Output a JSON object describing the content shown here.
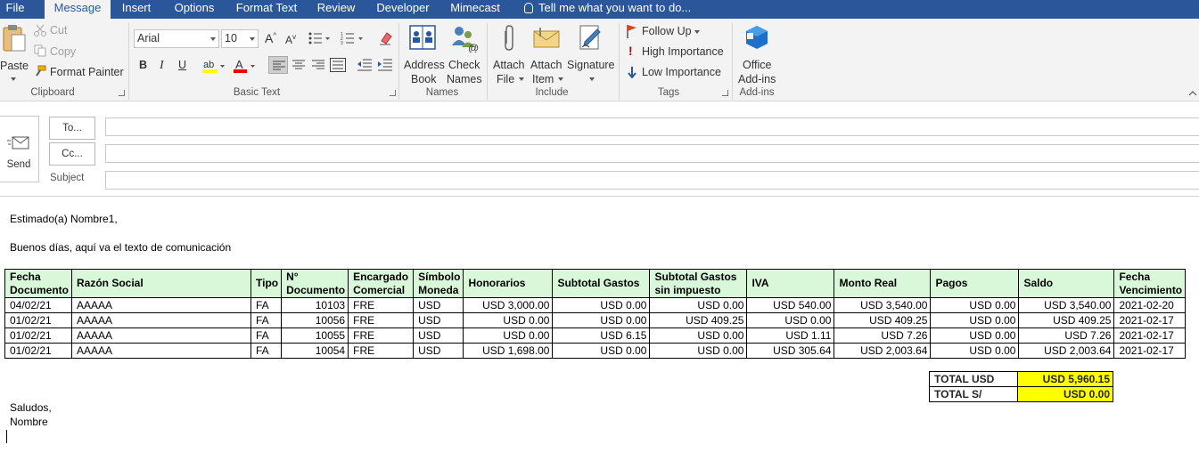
{
  "tabs": [
    {
      "label": "File",
      "active": false
    },
    {
      "label": "Message",
      "active": true
    },
    {
      "label": "Insert",
      "active": false
    },
    {
      "label": "Options",
      "active": false
    },
    {
      "label": "Format Text",
      "active": false
    },
    {
      "label": "Review",
      "active": false
    },
    {
      "label": "Developer",
      "active": false
    },
    {
      "label": "Mimecast",
      "active": false
    }
  ],
  "tell_me": "Tell me what you want to do...",
  "ribbon": {
    "clipboard": {
      "paste": "Paste",
      "cut": "Cut",
      "copy": "Copy",
      "format_painter": "Format Painter",
      "group": "Clipboard"
    },
    "basic_text": {
      "font": "Arial",
      "size": "10",
      "bold": "B",
      "italic": "I",
      "underline": "U",
      "group": "Basic Text"
    },
    "names": {
      "address_book_1": "Address",
      "address_book_2": "Book",
      "check_names_1": "Check",
      "check_names_2": "Names",
      "group": "Names"
    },
    "include": {
      "attach_file_1": "Attach",
      "attach_file_2": "File",
      "attach_item_1": "Attach",
      "attach_item_2": "Item",
      "signature": "Signature",
      "group": "Include"
    },
    "tags": {
      "follow_up": "Follow Up",
      "high_importance": "High Importance",
      "low_importance": "Low Importance",
      "group": "Tags"
    },
    "addins": {
      "office_addins_1": "Office",
      "office_addins_2": "Add-ins",
      "group": "Add-ins"
    }
  },
  "compose": {
    "send": "Send",
    "to": "To...",
    "cc": "Cc...",
    "subject": "Subject"
  },
  "body": {
    "greeting": "Estimado(a) Nombre1,",
    "intro": "Buenos días, aquí va el texto de comunicación",
    "closing_1": "Saludos,",
    "closing_2": "Nombre"
  },
  "table": {
    "headers": [
      {
        "l1": "Fecha",
        "l2": "Documento"
      },
      {
        "l1": "Razón Social",
        "l2": ""
      },
      {
        "l1": "Tipo",
        "l2": ""
      },
      {
        "l1": "N°",
        "l2": "Documento"
      },
      {
        "l1": "Encargado",
        "l2": "Comercial"
      },
      {
        "l1": "Símbolo",
        "l2": "Moneda"
      },
      {
        "l1": "Honorarios",
        "l2": ""
      },
      {
        "l1": "Subtotal Gastos",
        "l2": ""
      },
      {
        "l1": "Subtotal Gastos",
        "l2": "sin impuesto"
      },
      {
        "l1": "IVA",
        "l2": ""
      },
      {
        "l1": "Monto Real",
        "l2": ""
      },
      {
        "l1": "Pagos",
        "l2": ""
      },
      {
        "l1": "Saldo",
        "l2": ""
      },
      {
        "l1": "Fecha",
        "l2": "Vencimiento"
      }
    ],
    "rows": [
      [
        "04/02/21",
        "AAAAA",
        "FA",
        "10103",
        "FRE",
        "USD",
        "USD 3,000.00",
        "USD 0.00",
        "USD 0.00",
        "USD 540.00",
        "USD 3,540.00",
        "USD 0.00",
        "USD 3,540.00",
        "2021-02-20"
      ],
      [
        "01/02/21",
        "AAAAA",
        "FA",
        "10056",
        "FRE",
        "USD",
        "USD 0.00",
        "USD 0.00",
        "USD 409.25",
        "USD 0.00",
        "USD 409.25",
        "USD 0.00",
        "USD 409.25",
        "2021-02-17"
      ],
      [
        "01/02/21",
        "AAAAA",
        "FA",
        "10055",
        "FRE",
        "USD",
        "USD 0.00",
        "USD 6.15",
        "USD 0.00",
        "USD 1.11",
        "USD 7.26",
        "USD 0.00",
        "USD 7.26",
        "2021-02-17"
      ],
      [
        "01/02/21",
        "AAAAA",
        "FA",
        "10054",
        "FRE",
        "USD",
        "USD 1,698.00",
        "USD 0.00",
        "USD 0.00",
        "USD 305.64",
        "USD 2,003.64",
        "USD 0.00",
        "USD 2,003.64",
        "2021-02-17"
      ]
    ]
  },
  "totals": [
    {
      "label": "TOTAL USD",
      "value": "USD 5,960.15"
    },
    {
      "label": "TOTAL S/",
      "value": "USD 0.00"
    }
  ],
  "colors": {
    "ribbon_tab_bar": "#2b579a",
    "header_fill": "#d9f7d9",
    "total_fill": "#ffff00"
  }
}
